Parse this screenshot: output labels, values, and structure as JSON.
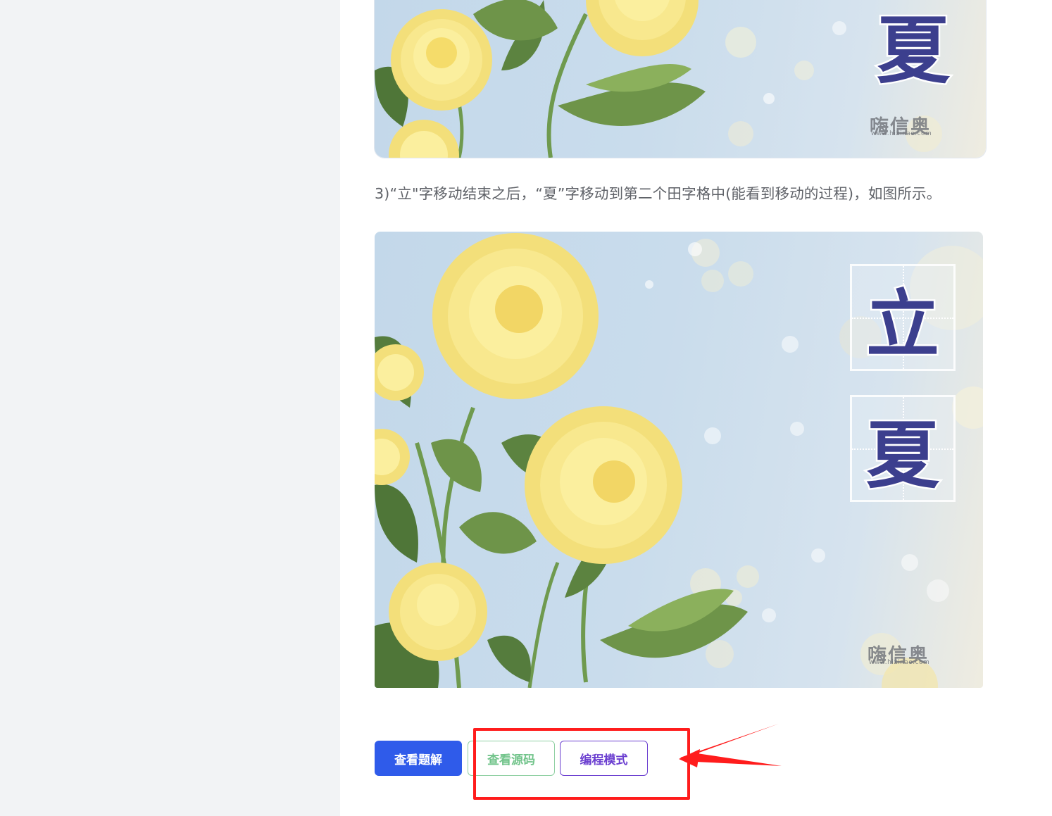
{
  "page": {
    "step_text": "3)“立\"字移动结束之后，“夏”字移动到第二个田字格中(能看到移动的过程)，如图所示。"
  },
  "figure_top": {
    "character": "夏",
    "watermark": "嗨信奥",
    "watermark_url": "www.hixinao.com"
  },
  "figure_main": {
    "characters": [
      "立",
      "夏"
    ],
    "watermark": "嗨信奥",
    "watermark_url": "www.hixinao.com"
  },
  "buttons": {
    "view_solution": "查看题解",
    "view_source": "查看源码",
    "programming_mode": "编程模式"
  },
  "colors": {
    "primary_button": "#2f5bea",
    "source_button": "#72c48b",
    "program_button": "#6b3fd0",
    "annotation_red": "#ff1c1c",
    "character_fill": "#3c3f8e"
  },
  "icons": {
    "annotation_arrow": "red-arrow-icon"
  }
}
